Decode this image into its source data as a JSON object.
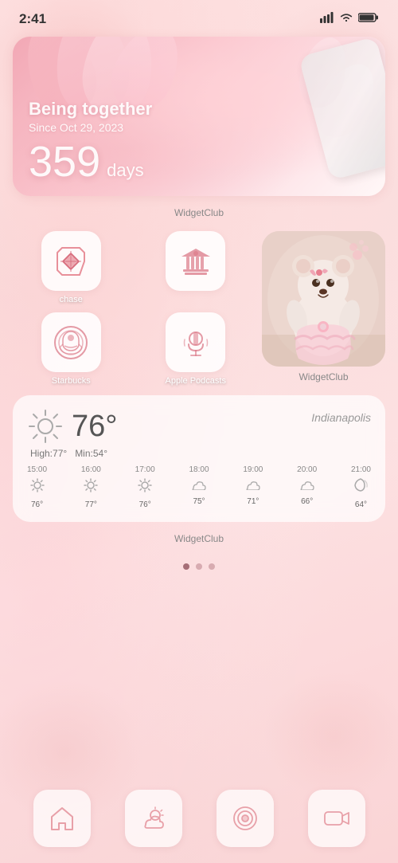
{
  "statusBar": {
    "time": "2:41",
    "signal": "▐▐▐▐",
    "wifi": "wifi",
    "battery": "battery"
  },
  "loveWidget": {
    "title": "Being together",
    "subtitle": "Since Oct 29, 2023",
    "days_count": "359",
    "days_label": "days",
    "attribution": "WidgetClub"
  },
  "apps": [
    {
      "name": "chase",
      "label": "chase"
    },
    {
      "name": "bank-placeholder",
      "label": ""
    },
    {
      "name": "starbucks",
      "label": "Starbucks"
    },
    {
      "name": "apple-podcasts",
      "label": "Apple Podcasts"
    }
  ],
  "photoWidget": {
    "attribution": "WidgetClub"
  },
  "weatherWidget": {
    "city": "Indianapolis",
    "temp": "76°",
    "high": "High:77°",
    "min": "Min:54°",
    "attribution": "WidgetClub",
    "hourly": [
      {
        "time": "15:00",
        "icon": "sun",
        "temp": "76°"
      },
      {
        "time": "16:00",
        "icon": "sun",
        "temp": "77°"
      },
      {
        "time": "17:00",
        "icon": "sun",
        "temp": "76°"
      },
      {
        "time": "18:00",
        "icon": "cloud",
        "temp": "75°"
      },
      {
        "time": "19:00",
        "icon": "cloud",
        "temp": "71°"
      },
      {
        "time": "20:00",
        "icon": "cloud",
        "temp": "66°"
      },
      {
        "time": "21:00",
        "icon": "moon",
        "temp": "64°"
      }
    ]
  },
  "pageDots": {
    "active": 0,
    "total": 3
  },
  "dock": {
    "items": [
      {
        "name": "home",
        "icon": "home"
      },
      {
        "name": "weather",
        "icon": "weather"
      },
      {
        "name": "target",
        "icon": "target"
      },
      {
        "name": "camera",
        "icon": "camera"
      }
    ]
  }
}
